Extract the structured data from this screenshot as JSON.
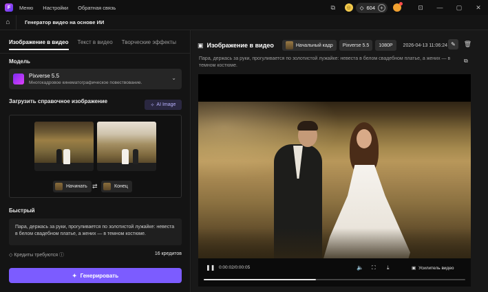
{
  "titlebar": {
    "logo_glyph": "F",
    "menu": [
      "Меню",
      "Настройки",
      "Обратная связь"
    ],
    "credits": "604"
  },
  "navbar": {
    "title": "Генератор видео на основе ИИ"
  },
  "left": {
    "tabs": [
      "Изображение в видео",
      "Текст в видео",
      "Творческие эффекты"
    ],
    "model_label": "Модель",
    "model_name": "Pixverse 5.5",
    "model_desc": "Многокадровое кинематографическое повествование.",
    "upload_label": "Загрузить справочное изображение",
    "ai_image_label": "AI Image",
    "start_label": "Начинать",
    "end_label": "Конец",
    "fast_label": "Быстрый",
    "prompt_text": "Пара, держась за руки, прогуливается по золотистой лужайке: невеста в белом свадебном платье, а жених — в темном костюме.",
    "credits_required_label": "Кредиты требуются",
    "credits_value": "16 кредитов",
    "generate_label": "Генерировать"
  },
  "right": {
    "title": "Изображение в видео",
    "chip_start_frame": "Начальный кадр",
    "chip_model": "Pixverse 5.5",
    "chip_resolution": "1080P",
    "date": "2026-04-13 11:06:24",
    "prompt_text": "Пара, держась за руки, прогуливается по золотистой лужайке: невеста в белом свадебном платье, а жених — в темном костюме.",
    "player": {
      "time": "0:00:02/0:00:05",
      "enhance_label": "Усилитель видео",
      "progress": 0.43
    }
  },
  "colors": {
    "accent": "#7c5cff",
    "background": "#141414",
    "coin": "#f2c94c"
  }
}
